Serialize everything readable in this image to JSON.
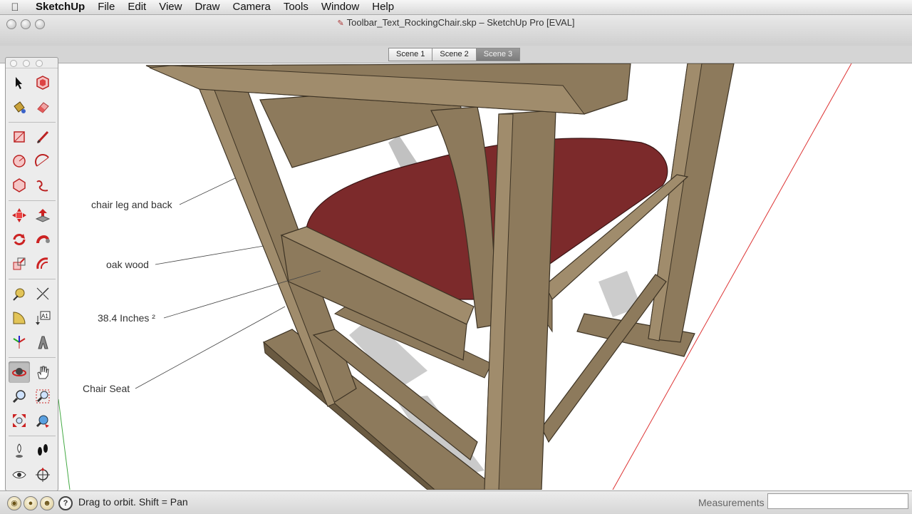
{
  "menubar": {
    "app": "SketchUp",
    "items": [
      "File",
      "Edit",
      "View",
      "Draw",
      "Camera",
      "Tools",
      "Window",
      "Help"
    ]
  },
  "window": {
    "title": "Toolbar_Text_RockingChair.skp – SketchUp Pro [EVAL]"
  },
  "scenes": [
    {
      "label": "Scene 1",
      "active": false
    },
    {
      "label": "Scene 2",
      "active": false
    },
    {
      "label": "Scene 3",
      "active": true
    }
  ],
  "tools": [
    "select-icon",
    "make-component-icon",
    "paint-bucket-icon",
    "eraser-icon",
    "rectangle-icon",
    "line-icon",
    "circle-icon",
    "arc-icon",
    "polygon-icon",
    "freehand-icon",
    "move-icon",
    "push-pull-icon",
    "rotate-icon",
    "follow-me-icon",
    "scale-icon",
    "offset-icon",
    "tape-measure-icon",
    "dimension-icon",
    "protractor-icon",
    "text-icon",
    "axes-icon",
    "3d-text-icon",
    "orbit-icon",
    "pan-icon",
    "zoom-icon",
    "zoom-window-icon",
    "zoom-extents-icon",
    "previous-view-icon",
    "position-camera-icon",
    "walk-icon",
    "look-around-icon",
    "section-plane-icon"
  ],
  "annotations": [
    {
      "label": "chair leg and back"
    },
    {
      "label": "oak wood"
    },
    {
      "label": "38.4 Inches ²"
    },
    {
      "label": "Chair Seat"
    }
  ],
  "status": {
    "hint": "Drag to orbit.  Shift = Pan",
    "measurements_label": "Measurements",
    "measurements_value": ""
  },
  "colors": {
    "wood": "#8d7a5c",
    "wood_light": "#a08c6c",
    "wood_dark": "#6a5a41",
    "seat": "#7c2a2b",
    "seat_dark": "#5e1c1e"
  }
}
